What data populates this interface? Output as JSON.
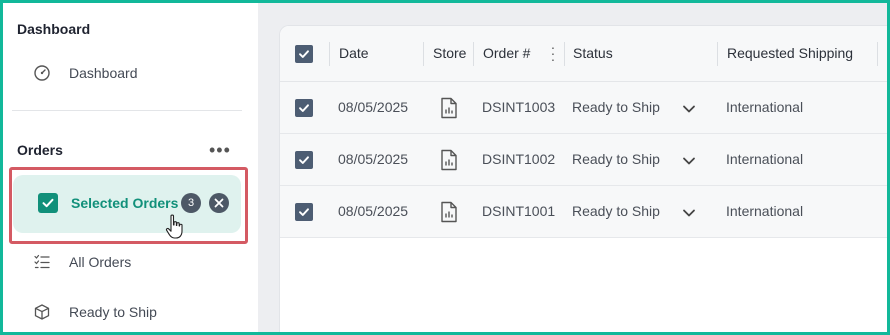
{
  "sidebar": {
    "dashboard_section": "Dashboard",
    "dashboard_item": "Dashboard",
    "orders_section": "Orders",
    "selected_orders": {
      "label": "Selected Orders",
      "count": "3"
    },
    "all_orders": "All Orders",
    "ready_to_ship": "Ready to Ship"
  },
  "table": {
    "columns": [
      "Date",
      "Store",
      "Order #",
      "Status",
      "Requested Shipping"
    ],
    "rows": [
      {
        "date": "08/05/2025",
        "order": "DSINT1003",
        "status": "Ready to Ship",
        "shipping": "International"
      },
      {
        "date": "08/05/2025",
        "order": "DSINT1002",
        "status": "Ready to Ship",
        "shipping": "International"
      },
      {
        "date": "08/05/2025",
        "order": "DSINT1001",
        "status": "Ready to Ship",
        "shipping": "International"
      }
    ]
  },
  "colors": {
    "accent": "#11907a",
    "frame": "#12b89a",
    "highlight_border": "#d45a63",
    "selected_bg": "#dff2ee",
    "checkbox": "#4d5d73"
  },
  "icons": {
    "dashboard": "gauge-icon",
    "selected": "checkbox-checked-icon",
    "clear": "close-circle-icon",
    "all_orders": "checklist-icon",
    "ready_to_ship": "box-icon",
    "store": "document-chart-icon",
    "status_dropdown": "chevron-down-icon"
  }
}
